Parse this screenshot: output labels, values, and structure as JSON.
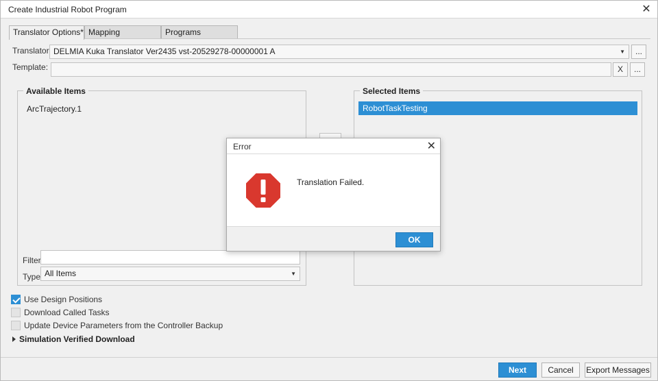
{
  "window": {
    "title": "Create Industrial Robot Program"
  },
  "tabs": [
    {
      "label": "Translator Options*"
    },
    {
      "label": "Mapping"
    },
    {
      "label": "Programs"
    }
  ],
  "translator": {
    "label": "Translator:",
    "value": "DELMIA Kuka Translator Ver2435 vst-20529278-00000001 A",
    "browse": "..."
  },
  "template": {
    "label": "Template:",
    "value": "",
    "clear": "X",
    "browse": "..."
  },
  "available": {
    "title": "Available Items",
    "items": [
      "ArcTrajectory.1"
    ],
    "filter_label": "Filter",
    "filter_value": "",
    "type_label": "Type",
    "type_value": "All Items"
  },
  "selected": {
    "title": "Selected Items",
    "items": [
      "RobotTaskTesting"
    ]
  },
  "options": {
    "use_design_positions": "Use Design Positions",
    "download_called_tasks": "Download Called Tasks",
    "update_device_params": "Update Device Parameters from the Controller Backup",
    "simulation_verified": "Simulation Verified Download"
  },
  "footer": {
    "next": "Next",
    "cancel": "Cancel",
    "export": "Export Messages"
  },
  "error_dialog": {
    "title": "Error",
    "message": "Translation Failed.",
    "ok": "OK",
    "icon": "stop-error-icon"
  },
  "colors": {
    "accent": "#2d8fd4",
    "error": "#d9382e"
  }
}
